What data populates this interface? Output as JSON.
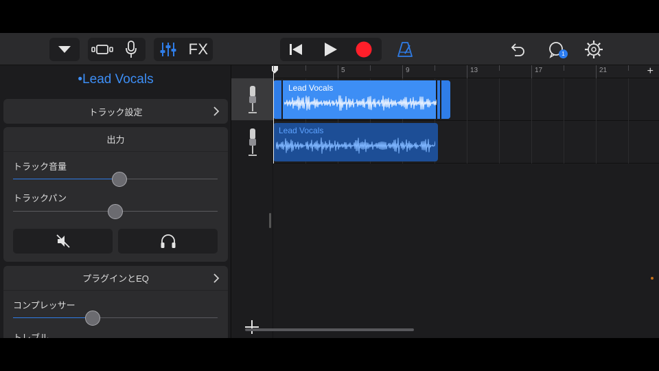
{
  "toolbar": {
    "fx_label": "FX",
    "chat_badge": "1",
    "icons": [
      "dropdown-triangle-icon",
      "track-view-icon",
      "microphone-icon",
      "mixer-controls-icon",
      "rewind-icon",
      "play-icon",
      "record-icon",
      "metronome-icon",
      "undo-icon",
      "loops-icon",
      "settings-gear-icon"
    ],
    "colors": {
      "accent": "#2f7de8",
      "record": "#ff1f2a",
      "badge": "#2b7cf0"
    }
  },
  "inspector": {
    "track_title": "•Lead Vocals",
    "track_settings_label": "トラック設定",
    "output_label": "出力",
    "volume_label": "トラック音量",
    "volume_value": 0.52,
    "pan_label": "トラックパン",
    "pan_value": 0.5,
    "plugins_label": "プラグインとEQ",
    "compressor_label": "コンプレッサー",
    "compressor_value": 0.38,
    "treble_label": "トレブル"
  },
  "timeline": {
    "bar_numbers": [
      "5",
      "9",
      "13",
      "17",
      "21"
    ],
    "regions": [
      {
        "name": "Lead Vocals",
        "track": 1,
        "selected": true,
        "color": "#3d8ef5"
      },
      {
        "name": "Lead Vocals",
        "track": 2,
        "selected": false,
        "color": "#1d4e96"
      }
    ]
  }
}
